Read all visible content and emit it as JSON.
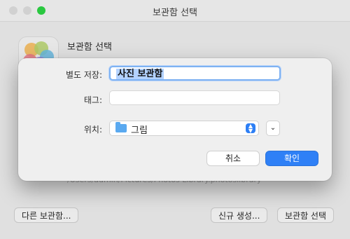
{
  "window": {
    "title": "보관함 선택"
  },
  "background": {
    "heading": "보관함 선택",
    "path": "/Users/admin/Pictures/Photos Library.photoslibrary",
    "buttons": {
      "other_library": "다른 보관함...",
      "create_new": "신규 생성...",
      "choose_library": "보관함 선택"
    }
  },
  "sheet": {
    "save_as_label": "별도 저장:",
    "save_as_value": "사진 보관함",
    "tags_label": "태그:",
    "tags_value": "",
    "where_label": "위치:",
    "where_value": "그림",
    "cancel_label": "취소",
    "ok_label": "확인"
  },
  "colors": {
    "accent": "#2f80f6",
    "zoom_button": "#2ac840",
    "selection": "#b3d2ff"
  },
  "icons": [
    "photos-app-icon",
    "folder-icon",
    "updown-chevron-icon",
    "chevron-down-icon"
  ]
}
